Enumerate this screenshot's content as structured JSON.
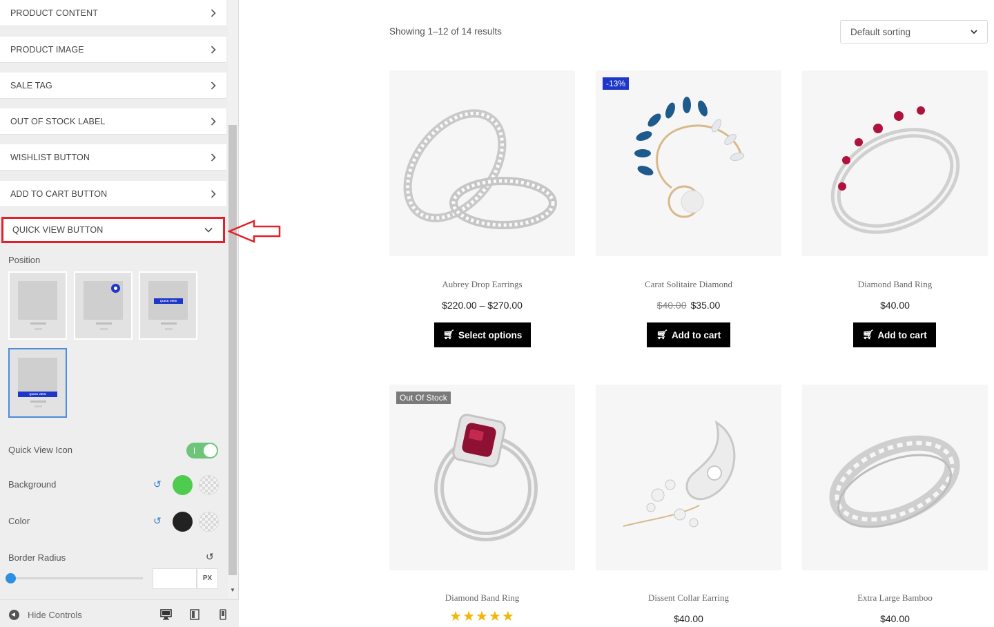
{
  "sidebar": {
    "sections": [
      {
        "label": "PRODUCT CONTENT"
      },
      {
        "label": "PRODUCT IMAGE"
      },
      {
        "label": "SALE TAG"
      },
      {
        "label": "OUT OF STOCK LABEL"
      },
      {
        "label": "WISHLIST BUTTON"
      },
      {
        "label": "ADD TO CART BUTTON"
      },
      {
        "label": "QUICK VIEW BUTTON"
      }
    ],
    "position_label": "Position",
    "position_thumb_text": "QUICK VIEW",
    "quick_view_icon_label": "Quick View Icon",
    "quick_view_icon_on": true,
    "background_label": "Background",
    "background_color": "#4fcb4f",
    "color_label": "Color",
    "color_value": "#222222",
    "border_radius_label": "Border Radius",
    "border_radius_value": "",
    "border_radius_unit": "PX",
    "footer": {
      "hide_controls": "Hide Controls"
    }
  },
  "main": {
    "results_text": "Showing 1–12 of 14 results",
    "sort_selected": "Default sorting",
    "products": [
      {
        "name": "Aubrey Drop Earrings",
        "price": "$220.00 – $270.00",
        "button": "Select options"
      },
      {
        "name": "Carat Solitaire Diamond",
        "old_price": "$40.00",
        "price": "$35.00",
        "button": "Add to cart",
        "badge": "-13%"
      },
      {
        "name": "Diamond Band Ring",
        "price": "$40.00",
        "button": "Add to cart"
      },
      {
        "name": "Diamond Band Ring",
        "badge": "Out Of Stock",
        "stars": "★★★★★",
        "rating": 5
      },
      {
        "name": "Dissent Collar Earring",
        "price": "$40.00"
      },
      {
        "name": "Extra Large Bamboo",
        "price": "$40.00"
      }
    ]
  },
  "colors": {
    "accent_blue": "#1f37c8",
    "annotation_red": "#e2212b"
  }
}
